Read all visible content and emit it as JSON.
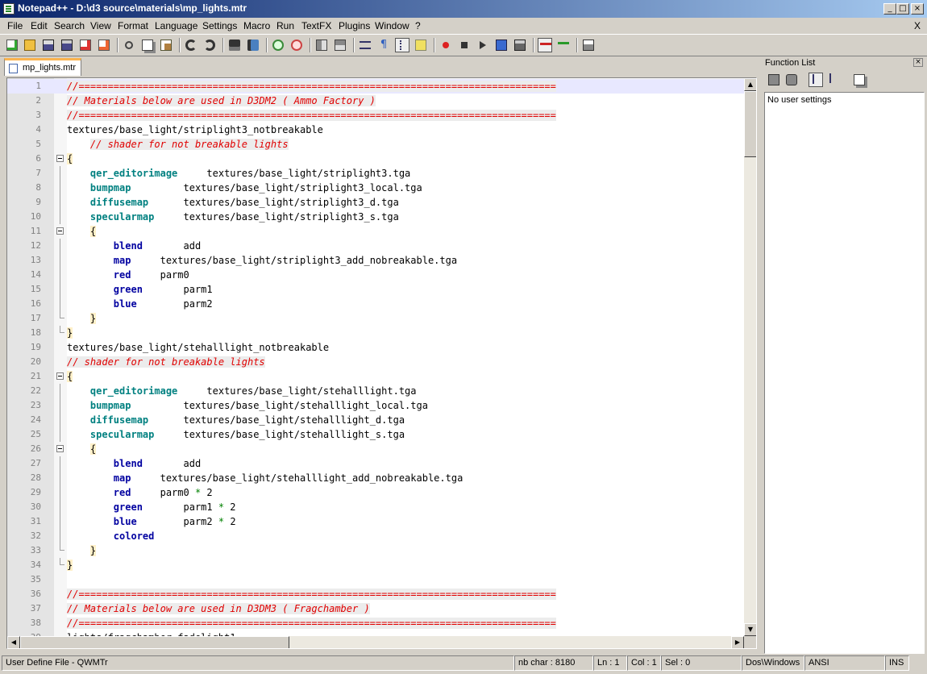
{
  "window": {
    "title": "Notepad++ - D:\\d3 source\\materials\\mp_lights.mtr",
    "minimize": "_",
    "maximize": "□",
    "close": "×"
  },
  "menu": [
    "File",
    "Edit",
    "Search",
    "View",
    "Format",
    "Language",
    "Settings",
    "Macro",
    "Run",
    "TextFX",
    "Plugins",
    "Window",
    "?"
  ],
  "menu_close": "X",
  "toolbar_icons": [
    "new-file-icon",
    "open-file-icon",
    "save-icon",
    "save-all-icon",
    "close-icon",
    "close-all-icon",
    "cut-icon",
    "copy-icon",
    "paste-icon",
    "undo-icon",
    "redo-icon",
    "find-icon",
    "replace-icon",
    "zoom-in-icon",
    "zoom-out-icon",
    "sync-vertical-icon",
    "sync-horizontal-icon",
    "word-wrap-icon",
    "show-all-chars-icon",
    "indent-guide-icon",
    "user-lang-icon",
    "record-macro-icon",
    "stop-record-icon",
    "playback-icon",
    "run-macro-multiple-icon",
    "save-macro-icon",
    "spell-check-icon",
    "spell-check-auto-icon",
    "print-icon"
  ],
  "tab": {
    "label": "mp_lights.mtr"
  },
  "editor": {
    "current_line": 1,
    "lines": [
      {
        "n": "1",
        "parts": [
          [
            "c",
            "//=================================================================================="
          ]
        ]
      },
      {
        "n": "2",
        "parts": [
          [
            "c",
            "// Materials below are used in D3DM2 ( Ammo Factory )"
          ]
        ]
      },
      {
        "n": "3",
        "parts": [
          [
            "c",
            "//=================================================================================="
          ]
        ]
      },
      {
        "n": "4",
        "parts": [
          [
            "t",
            "textures/base_light/striplight3_notbreakable"
          ]
        ]
      },
      {
        "n": "5",
        "parts": [
          [
            "t",
            "    "
          ],
          [
            "c",
            "// shader for not breakable lights"
          ]
        ]
      },
      {
        "n": "6",
        "fold": "open",
        "parts": [
          [
            "b",
            "{"
          ]
        ]
      },
      {
        "n": "7",
        "fold": "line",
        "parts": [
          [
            "t",
            "    "
          ],
          [
            "k",
            "qer_editorimage"
          ],
          [
            "t",
            "     textures/base_light/striplight3.tga"
          ]
        ]
      },
      {
        "n": "8",
        "fold": "line",
        "parts": [
          [
            "t",
            "    "
          ],
          [
            "k",
            "bumpmap"
          ],
          [
            "t",
            "         textures/base_light/striplight3_local.tga"
          ]
        ]
      },
      {
        "n": "9",
        "fold": "line",
        "parts": [
          [
            "t",
            "    "
          ],
          [
            "k",
            "diffusemap"
          ],
          [
            "t",
            "      textures/base_light/striplight3_d.tga"
          ]
        ]
      },
      {
        "n": "10",
        "fold": "line",
        "parts": [
          [
            "t",
            "    "
          ],
          [
            "k",
            "specularmap"
          ],
          [
            "t",
            "     textures/base_light/striplight3_s.tga"
          ]
        ]
      },
      {
        "n": "11",
        "fold": "open",
        "parts": [
          [
            "t",
            "    "
          ],
          [
            "b",
            "{"
          ]
        ]
      },
      {
        "n": "12",
        "fold": "line",
        "parts": [
          [
            "t",
            "        "
          ],
          [
            "k2",
            "blend"
          ],
          [
            "t",
            "       add"
          ]
        ]
      },
      {
        "n": "13",
        "fold": "line",
        "parts": [
          [
            "t",
            "        "
          ],
          [
            "k2",
            "map"
          ],
          [
            "t",
            "     textures/base_light/striplight3_add_nobreakable.tga"
          ]
        ]
      },
      {
        "n": "14",
        "fold": "line",
        "parts": [
          [
            "t",
            "        "
          ],
          [
            "k2",
            "red"
          ],
          [
            "t",
            "     parm0"
          ]
        ]
      },
      {
        "n": "15",
        "fold": "line",
        "parts": [
          [
            "t",
            "        "
          ],
          [
            "k2",
            "green"
          ],
          [
            "t",
            "       parm1"
          ]
        ]
      },
      {
        "n": "16",
        "fold": "line",
        "parts": [
          [
            "t",
            "        "
          ],
          [
            "k2",
            "blue"
          ],
          [
            "t",
            "        parm2"
          ]
        ]
      },
      {
        "n": "17",
        "fold": "end",
        "parts": [
          [
            "t",
            "    "
          ],
          [
            "b",
            "}"
          ]
        ]
      },
      {
        "n": "18",
        "fold": "end",
        "parts": [
          [
            "b",
            "}"
          ]
        ]
      },
      {
        "n": "19",
        "parts": [
          [
            "t",
            "textures/base_light/stehalllight_notbreakable"
          ]
        ]
      },
      {
        "n": "20",
        "parts": [
          [
            "c",
            "// shader for not breakable lights"
          ]
        ]
      },
      {
        "n": "21",
        "fold": "open",
        "parts": [
          [
            "b",
            "{"
          ]
        ]
      },
      {
        "n": "22",
        "fold": "line",
        "parts": [
          [
            "t",
            "    "
          ],
          [
            "k",
            "qer_editorimage"
          ],
          [
            "t",
            "     textures/base_light/stehalllight.tga"
          ]
        ]
      },
      {
        "n": "23",
        "fold": "line",
        "parts": [
          [
            "t",
            "    "
          ],
          [
            "k",
            "bumpmap"
          ],
          [
            "t",
            "         textures/base_light/stehalllight_local.tga"
          ]
        ]
      },
      {
        "n": "24",
        "fold": "line",
        "parts": [
          [
            "t",
            "    "
          ],
          [
            "k",
            "diffusemap"
          ],
          [
            "t",
            "      textures/base_light/stehalllight_d.tga"
          ]
        ]
      },
      {
        "n": "25",
        "fold": "line",
        "parts": [
          [
            "t",
            "    "
          ],
          [
            "k",
            "specularmap"
          ],
          [
            "t",
            "     textures/base_light/stehalllight_s.tga"
          ]
        ]
      },
      {
        "n": "26",
        "fold": "open",
        "parts": [
          [
            "t",
            "    "
          ],
          [
            "b",
            "{"
          ]
        ]
      },
      {
        "n": "27",
        "fold": "line",
        "parts": [
          [
            "t",
            "        "
          ],
          [
            "k2",
            "blend"
          ],
          [
            "t",
            "       add"
          ]
        ]
      },
      {
        "n": "28",
        "fold": "line",
        "parts": [
          [
            "t",
            "        "
          ],
          [
            "k2",
            "map"
          ],
          [
            "t",
            "     textures/base_light/stehalllight_add_nobreakable.tga"
          ]
        ]
      },
      {
        "n": "29",
        "fold": "line",
        "parts": [
          [
            "t",
            "        "
          ],
          [
            "k2",
            "red"
          ],
          [
            "t",
            "     parm0 "
          ],
          [
            "o",
            "*"
          ],
          [
            "t",
            " 2"
          ]
        ]
      },
      {
        "n": "30",
        "fold": "line",
        "parts": [
          [
            "t",
            "        "
          ],
          [
            "k2",
            "green"
          ],
          [
            "t",
            "       parm1 "
          ],
          [
            "o",
            "*"
          ],
          [
            "t",
            " 2"
          ]
        ]
      },
      {
        "n": "31",
        "fold": "line",
        "parts": [
          [
            "t",
            "        "
          ],
          [
            "k2",
            "blue"
          ],
          [
            "t",
            "        parm2 "
          ],
          [
            "o",
            "*"
          ],
          [
            "t",
            " 2"
          ]
        ]
      },
      {
        "n": "32",
        "fold": "line",
        "parts": [
          [
            "t",
            "        "
          ],
          [
            "k2",
            "colored"
          ]
        ]
      },
      {
        "n": "33",
        "fold": "end",
        "parts": [
          [
            "t",
            "    "
          ],
          [
            "b",
            "}"
          ]
        ]
      },
      {
        "n": "34",
        "fold": "end",
        "parts": [
          [
            "b",
            "}"
          ]
        ]
      },
      {
        "n": "35",
        "parts": [
          [
            "t",
            ""
          ]
        ]
      },
      {
        "n": "36",
        "parts": [
          [
            "c",
            "//=================================================================================="
          ]
        ]
      },
      {
        "n": "37",
        "parts": [
          [
            "c",
            "// Materials below are used in D3DM3 ( Fragchamber )"
          ]
        ]
      },
      {
        "n": "38",
        "parts": [
          [
            "c",
            "//=================================================================================="
          ]
        ]
      },
      {
        "n": "39",
        "parts": [
          [
            "t",
            "lights/fragchamber_fadelight1"
          ]
        ]
      }
    ]
  },
  "function_list": {
    "title": "Function List",
    "close": "×",
    "empty_text": "No user settings",
    "toolbar_icons": [
      "reload-icon",
      "search-function-icon",
      "sort-ascending-icon",
      "sort-descending-icon",
      "copy-icon"
    ]
  },
  "status": {
    "language": "User Define File - QWMTr",
    "nb_char": "nb char : 8180",
    "ln": "Ln : 1",
    "col": "Col : 1",
    "sel": "Sel : 0",
    "eol": "Dos\\Windows",
    "encoding": "ANSI",
    "mode": "INS"
  }
}
